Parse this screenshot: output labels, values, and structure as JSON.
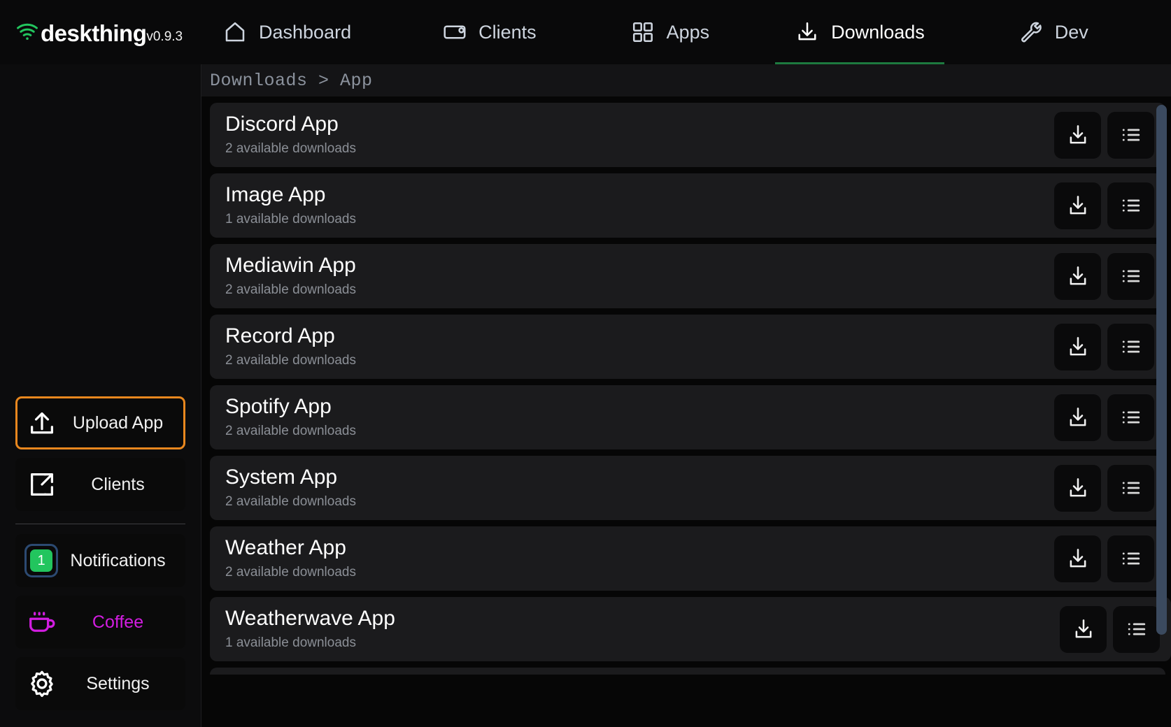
{
  "brand": {
    "name": "deskthing",
    "version": "v0.9.3",
    "wifi_icon": "wifi-icon",
    "accent": "#22c55e"
  },
  "topnav": {
    "items": [
      {
        "label": "Dashboard",
        "icon": "home-icon",
        "active": false
      },
      {
        "label": "Clients",
        "icon": "device-tablet-icon",
        "active": false
      },
      {
        "label": "Apps",
        "icon": "grid-icon",
        "active": false
      },
      {
        "label": "Downloads",
        "icon": "download-icon",
        "active": true
      },
      {
        "label": "Dev",
        "icon": "wrench-icon",
        "active": false
      }
    ],
    "active_underline_color": "#1d7a3f"
  },
  "breadcrumb": {
    "text": "Downloads > App",
    "parent": "Downloads",
    "separator": ">",
    "current": "App"
  },
  "sidebar": {
    "items": [
      {
        "label": "Upload App",
        "icon": "upload-icon",
        "highlighted": true,
        "highlight_color": "#e8871e"
      },
      {
        "label": "Clients",
        "icon": "external-link-icon",
        "highlighted": false
      },
      {
        "label": "Notifications",
        "icon": "notification-badge",
        "badge_count": "1",
        "badge_color": "#22c55e",
        "badge_border": "#2c4a72",
        "highlighted": false
      },
      {
        "label": "Coffee",
        "icon": "coffee-icon",
        "text_color": "#d21de0",
        "highlighted": false
      },
      {
        "label": "Settings",
        "icon": "gear-icon",
        "highlighted": false
      }
    ]
  },
  "downloads": {
    "download_button_label": "download-app",
    "details_button_label": "view-releases",
    "apps": [
      {
        "title": "Discord App",
        "subtitle": "2 available downloads"
      },
      {
        "title": "Image App",
        "subtitle": "1 available downloads"
      },
      {
        "title": "Mediawin App",
        "subtitle": "2 available downloads"
      },
      {
        "title": "Record App",
        "subtitle": "2 available downloads"
      },
      {
        "title": "Spotify App",
        "subtitle": "2 available downloads"
      },
      {
        "title": "System App",
        "subtitle": "2 available downloads"
      },
      {
        "title": "Weather App",
        "subtitle": "2 available downloads"
      },
      {
        "title": "Weatherwave App",
        "subtitle": "1 available downloads"
      }
    ]
  },
  "scrollbar": {
    "color": "#3b4a5f"
  }
}
